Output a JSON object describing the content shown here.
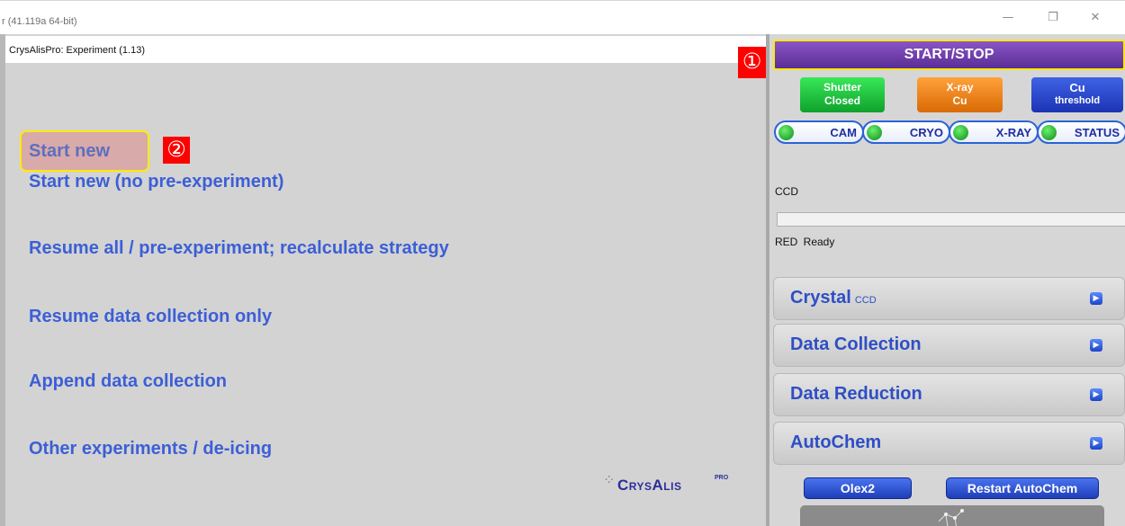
{
  "window": {
    "title": "r (41.119a 64-bit)",
    "minimize_glyph": "—",
    "maximize_glyph": "❐",
    "close_glyph": "✕"
  },
  "experiment": {
    "header": "CrysAlisPro: Experiment (1.13)",
    "start_new": "Start new",
    "items": [
      "Start new (no pre-experiment)",
      "Resume all / pre-experiment; recalculate strategy",
      "Resume data collection only",
      "Append data collection",
      "Other experiments / de-icing"
    ],
    "logo_text": "CrysAlis",
    "logo_superscript": "PRO"
  },
  "annotations": {
    "badge_1": "①",
    "badge_2": "②"
  },
  "controls": {
    "start_stop": "START/STOP",
    "shutter": {
      "line1": "Shutter",
      "line2": "Closed"
    },
    "xray": {
      "line1": "X-ray",
      "line2": "Cu"
    },
    "cu": {
      "line1": "Cu",
      "line2": "threshold"
    },
    "status_pills": [
      "CAM",
      "CRYO",
      "X-RAY",
      "STATUS"
    ],
    "detector_label": "CCD",
    "progress": 0,
    "ready_status": "RED  Ready"
  },
  "sections": {
    "crystal": {
      "title": "Crystal",
      "subtitle": "CCD"
    },
    "data_collection": {
      "title": "Data Collection"
    },
    "data_reduction": {
      "title": "Data Reduction"
    },
    "autochem": {
      "title": "AutoChem"
    }
  },
  "autochem_buttons": {
    "olex2": "Olex2",
    "restart": "Restart AutoChem"
  },
  "icons": {
    "section_arrow": "▶",
    "status_dot": "green-led"
  },
  "colors": {
    "link_blue": "#3c5fd6",
    "highlight_yellow": "#ffeb00",
    "badge_red": "#ff0000",
    "start_stop_purple": "#6b3aab",
    "shutter_green": "#19b53a",
    "xray_orange": "#ee8215",
    "cu_blue": "#2a45cc"
  }
}
